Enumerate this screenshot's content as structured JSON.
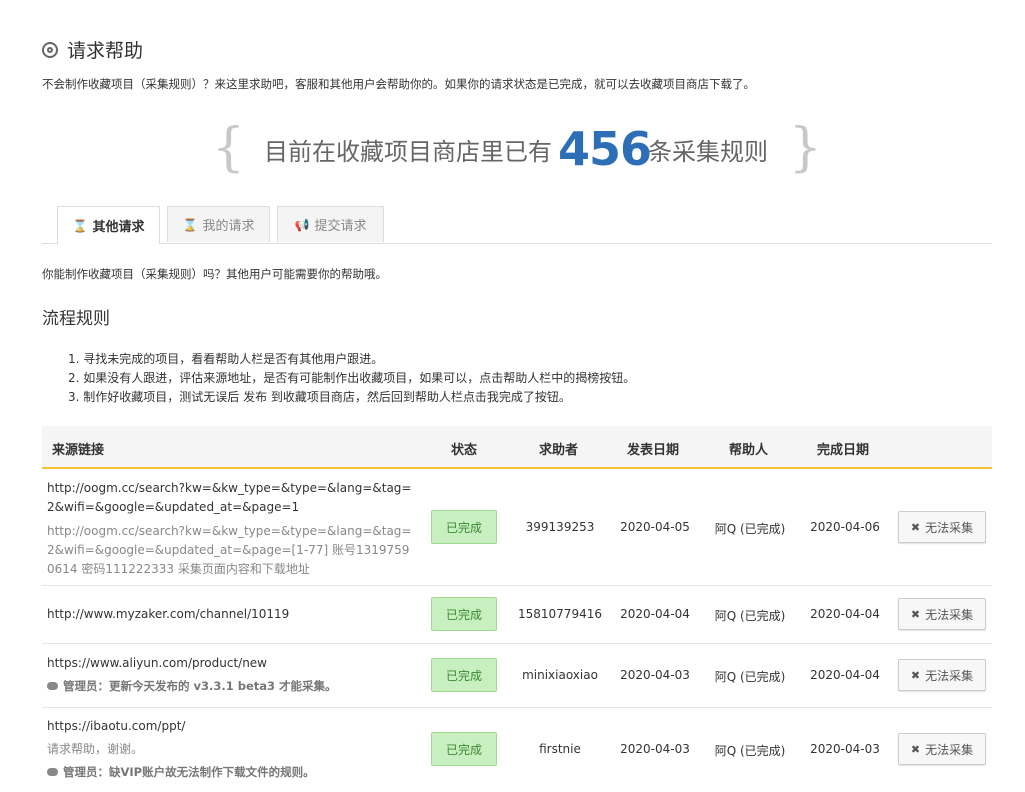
{
  "header": {
    "title": "请求帮助",
    "description": "不会制作收藏项目（采集规则）？来这里求助吧，客服和其他用户会帮助你的。如果你的请求状态是已完成，就可以去收藏项目商店下载了。"
  },
  "stat": {
    "open_brace": "{",
    "prefix": "目前在收藏项目商店里已有",
    "count": "456",
    "suffix": "条采集规则",
    "close_brace": "}"
  },
  "tabs": [
    {
      "label": "其他请求",
      "icon": "hourglass-icon"
    },
    {
      "label": "我的请求",
      "icon": "hourglass-icon"
    },
    {
      "label": "提交请求",
      "icon": "megaphone-icon"
    }
  ],
  "subtitle": "你能制作收藏项目（采集规则）吗？其他用户可能需要你的帮助哦。",
  "rules": {
    "heading": "流程规则",
    "items": [
      "1. 寻找未完成的项目，看看帮助人栏是否有其他用户跟进。",
      "2. 如果没有人跟进，评估来源地址，是否有可能制作出收藏项目，如果可以，点击帮助人栏中的揭榜按钮。",
      "3. 制作好收藏项目，测试无误后 发布 到收藏项目商店，然后回到帮助人栏点击我完成了按钮。"
    ]
  },
  "table": {
    "headers": [
      "来源链接",
      "状态",
      "求助者",
      "发表日期",
      "帮助人",
      "完成日期"
    ],
    "rows": [
      {
        "url": "http://oogm.cc/search?kw=&kw_type=&type=&lang=&tag=2&wifi=&google=&updated_at=&page=1",
        "note": "http://oogm.cc/search?kw=&kw_type=&type=&lang=&tag=2&wifi=&google=&updated_at=&page=[1-77] 账号13197590614 密码111222333 采集页面内容和下载地址",
        "admin": "",
        "status": "已完成",
        "requester": "399139253",
        "posted": "2020-04-05",
        "helper": "阿Q (已完成)",
        "completed": "2020-04-06",
        "action": "无法采集"
      },
      {
        "url": "http://www.myzaker.com/channel/10119",
        "note": "",
        "admin": "",
        "status": "已完成",
        "requester": "15810779416",
        "posted": "2020-04-04",
        "helper": "阿Q (已完成)",
        "completed": "2020-04-04",
        "action": "无法采集"
      },
      {
        "url": "https://www.aliyun.com/product/new",
        "note": "",
        "admin": "管理员：更新今天发布的 v3.3.1 beta3 才能采集。",
        "status": "已完成",
        "requester": "minixiaoxiao",
        "posted": "2020-04-03",
        "helper": "阿Q (已完成)",
        "completed": "2020-04-04",
        "action": "无法采集"
      },
      {
        "url": "https://ibaotu.com/ppt/",
        "note": "请求帮助，谢谢。",
        "admin": "管理员：缺VIP账户故无法制作下载文件的规则。",
        "status": "已完成",
        "requester": "firstnie",
        "posted": "2020-04-03",
        "helper": "阿Q (已完成)",
        "completed": "2020-04-03",
        "action": "无法采集"
      }
    ]
  }
}
